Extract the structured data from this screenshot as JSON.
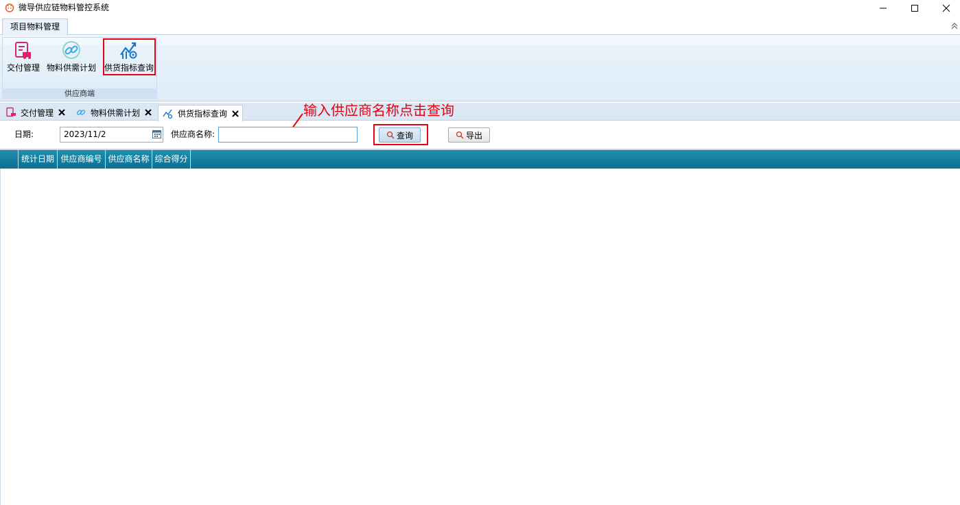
{
  "window": {
    "title": "微导供应链物料管控系统",
    "controls": {
      "minimize": "—",
      "maximize": "☐",
      "close": "✕"
    }
  },
  "ribbon": {
    "tab_label": "项目物料管理",
    "group_label": "供应商端",
    "buttons": [
      {
        "label": "交付管理",
        "icon": "delivery-truck-icon"
      },
      {
        "label": "物料供需计划",
        "icon": "link-chain-icon"
      },
      {
        "label": "供货指标查询",
        "icon": "chart-gear-icon"
      }
    ]
  },
  "doc_tabs": [
    {
      "label": "交付管理",
      "icon": "delivery-truck-icon"
    },
    {
      "label": "物料供需计划",
      "icon": "link-chain-icon"
    },
    {
      "label": "供货指标查询",
      "icon": "chart-gear-icon",
      "active": true
    }
  ],
  "annotation": {
    "text": "输入供应商名称点击查询",
    "color": "#e60012"
  },
  "filters": {
    "date_label": "日期:",
    "date_value": "2023/11/2",
    "supplier_label": "供应商名称:",
    "supplier_value": "",
    "query_button": "查询",
    "export_button": "导出"
  },
  "grid": {
    "columns": [
      "统计日期",
      "供应商编号",
      "供应商名称",
      "综合得分"
    ],
    "rows": []
  }
}
